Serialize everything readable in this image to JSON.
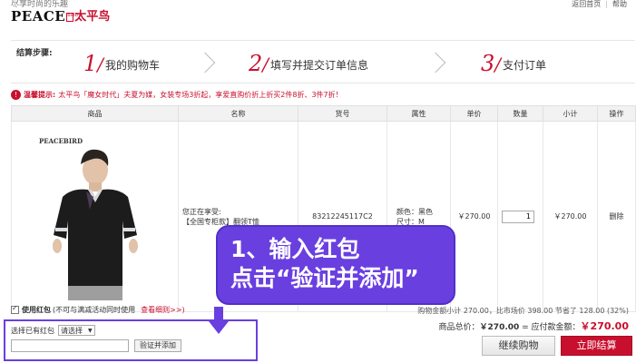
{
  "header": {
    "slogan": "尽享时尚的乐趣",
    "logo_en": "PEACE",
    "logo_seal": "BIRD",
    "logo_cn": "太平鸟",
    "links": [
      "返回首页",
      "帮助"
    ]
  },
  "steps": {
    "label": "结算步骤:",
    "items": [
      {
        "num": "1",
        "text": "我的购物车"
      },
      {
        "num": "2",
        "text": "填写并提交订单信息"
      },
      {
        "num": "3",
        "text": "支付订单"
      }
    ]
  },
  "tip": {
    "icon": "!",
    "label": "温馨提示:",
    "text": "太平鸟「魔女时代」夫夏为媒，女装专场3折起，享爱直购价折上折买2件8折、3件7折！"
  },
  "table": {
    "headers": [
      "商品",
      "名称",
      "货号",
      "属性",
      "单价",
      "数量",
      "小计",
      "操作"
    ],
    "rows": [
      {
        "image_brand": "PEACEBIRD",
        "name_line1": "您正在享受:",
        "name_line2": "【全国专柜款】翻领T恤",
        "sku": "83212245117C2",
        "attr_color": "颜色：黑色",
        "attr_size": "尺寸：M",
        "price": "￥270.00",
        "qty": "1",
        "subtotal": "￥270.00",
        "op": "删除"
      }
    ]
  },
  "callout": {
    "line1": "1、输入红包",
    "line2": "点击“验证并添加”"
  },
  "coupon": {
    "title": "使用红包",
    "note": "(不可与满减活动同时使用",
    "link": "查看细则>>)",
    "select_label": "选择已有红包",
    "select_value": "请选择",
    "input_value": "",
    "verify_label": "验证并添加"
  },
  "summary": {
    "line1": "购物金额小计 270.00，比市场价 398.00 节省了 128.00 (32%)",
    "total_label": "商品总价：",
    "total_value": "￥270.00",
    "pay_label": " = 应付款金额：",
    "pay_value": "￥270.00"
  },
  "buttons": {
    "continue": "继续购物",
    "checkout": "立即结算"
  },
  "colors": {
    "brand_red": "#c8102e",
    "callout_purple": "#6a3fe0"
  }
}
